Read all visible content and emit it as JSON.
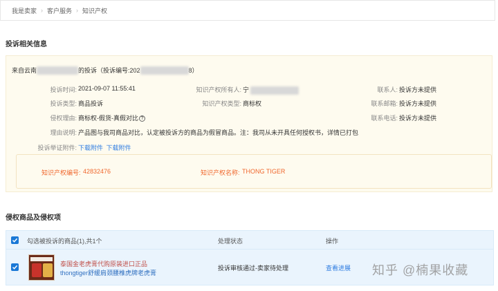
{
  "breadcrumb": [
    "我是卖家",
    "客户服务",
    "知识产权"
  ],
  "complaint_section_title": "投诉相关信息",
  "from": {
    "prefix": "来自云南",
    "middle": "的投诉（投诉编号:202",
    "suffix": "8）"
  },
  "fields": {
    "time_label": "投诉时间:",
    "time_value": "2021-09-07 11:55:41",
    "type_label": "投诉类型:",
    "type_value": "商品投诉",
    "reason_label": "侵权理由:",
    "reason_value": "商标权-假货-真假对比",
    "explain_label": "理由说明:",
    "explain_value": "产品图与我司商品对比，认定被投诉方的商品为假冒商品。注：我司从未开具任何授权书，详情已打包",
    "attach_label": "投诉举证附件:",
    "attach1": "下载附件",
    "attach2": "下载附件",
    "owner_label": "知识产权所有人:",
    "owner_value": "宁",
    "iptype_label": "知识产权类型:",
    "iptype_value": "商标权",
    "contact_label": "联系人:",
    "contact_value": "投诉方未提供",
    "email_label": "联系邮箱:",
    "email_value": "投诉方未提供",
    "phone_label": "联系电话:",
    "phone_value": "投诉方未提供"
  },
  "ip": {
    "no_label": "知识产权编号:",
    "no_value": "42832476",
    "name_label": "知识产权名称:",
    "name_value": "THONG TIGER"
  },
  "goods_section_title": "侵权商品及侵权项",
  "table": {
    "select_label": "勾选被投诉的商品(1),共1个",
    "status_header": "处理状态",
    "action_header": "操作",
    "row": {
      "title_line1": "泰国金老虎膏代购原装进口正品",
      "title_line2": "thongtiger舒缓肩颈腰椎虎牌老虎膏",
      "status": "投诉审核通过-卖家待处理",
      "action": "查看进展"
    }
  },
  "watermark": "知乎 @楠果收藏",
  "colors": {
    "accent_blue": "#1a78d6",
    "ip_orange": "#f0672d",
    "panel_bg": "#fefbef"
  }
}
